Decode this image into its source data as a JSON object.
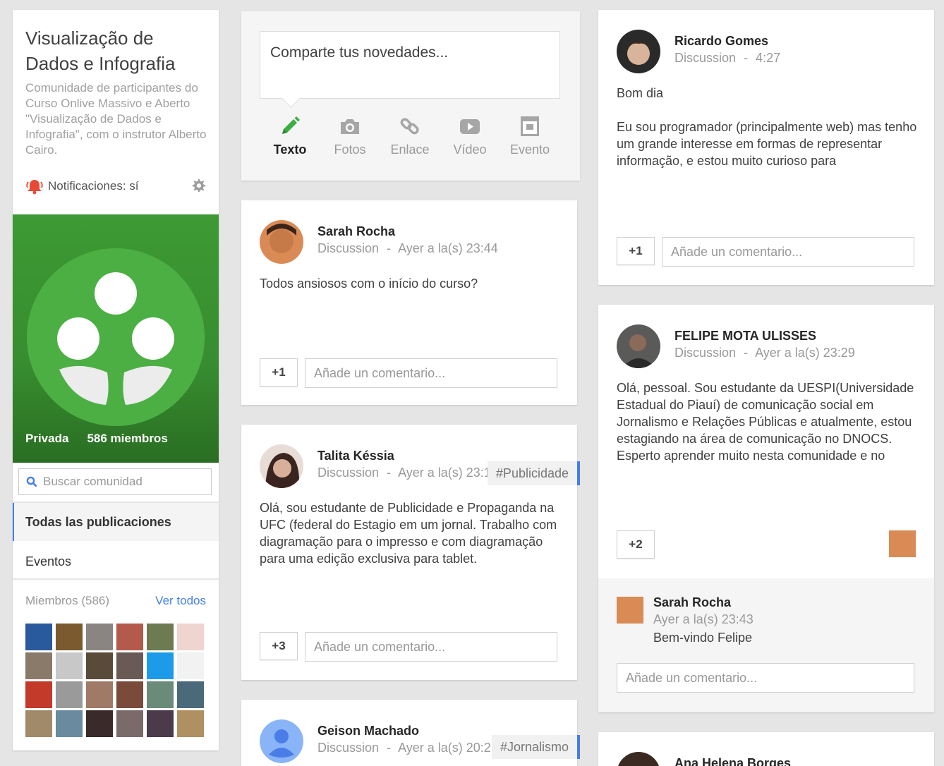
{
  "community": {
    "title": "Visualização de Dados e Infografia",
    "description": "Comunidade de participantes do Curso Onlive Massivo e Aberto \"Visualização de Dados e Infografia\", com o instrutor Alberto Cairo.",
    "notifications_label": "Notificaciones: sí",
    "privacy": "Privada",
    "members_label": "586 miembros",
    "search_placeholder": "Buscar comunidad",
    "nav": [
      {
        "label": "Todas las publicaciones",
        "active": true
      },
      {
        "label": "Eventos",
        "active": false
      }
    ],
    "members_heading": "Miembros (586)",
    "see_all": "Ver todos",
    "hero_color": "#3d9a34"
  },
  "share": {
    "placeholder": "Comparte tus novedades...",
    "actions": [
      {
        "label": "Texto",
        "icon": "pencil-icon"
      },
      {
        "label": "Fotos",
        "icon": "camera-icon"
      },
      {
        "label": "Enlace",
        "icon": "link-icon"
      },
      {
        "label": "Vídeo",
        "icon": "video-icon"
      },
      {
        "label": "Evento",
        "icon": "calendar-icon"
      }
    ]
  },
  "comment_placeholder": "Añade un comentario...",
  "posts": [
    {
      "author": "Sarah Rocha",
      "category": "Discussion",
      "time": "Ayer a la(s) 23:44",
      "body": "Todos ansiosos com o início do curso?",
      "plus": "+1"
    },
    {
      "author": "Talita Késsia",
      "category": "Discussion",
      "time": "Ayer a la(s) 23:1",
      "tag": "#Publicidade",
      "body": "Olá, sou estudante de Publicidade e Propaganda na UFC (federal do Estagio em um jornal. Trabalho com diagramação para o impresso e com diagramação para uma edição exclusiva para tablet.",
      "plus": "+3"
    },
    {
      "author": "Geison Machado",
      "category": "Discussion",
      "time": "Ayer a la(s) 20:2",
      "tag": "#Jornalismo"
    },
    {
      "author": "Ricardo Gomes",
      "category": "Discussion",
      "time": "4:27",
      "body": "Bom dia\n\nEu sou programador (principalmente web) mas tenho um grande interesse em formas de representar informação, e estou muito curioso para",
      "plus": "+1"
    },
    {
      "author": "FELIPE MOTA ULISSES",
      "category": "Discussion",
      "time": "Ayer a la(s) 23:29",
      "body": "Olá, pessoal. Sou estudante da UESPI(Universidade Estadual do Piauí) de comunicação social em Jornalismo e Relações Públicas e atualmente, estou estagiando na área de comunicação no DNOCS. Esperto aprender muito nesta comunidade e no",
      "plus": "+2",
      "comment": {
        "author": "Sarah Rocha",
        "time": "Ayer a la(s) 23:43",
        "text": "Bem-vindo Felipe"
      }
    },
    {
      "author": "Ana Helena Borges"
    }
  ],
  "separator": "-",
  "accent_color": "#427fed"
}
